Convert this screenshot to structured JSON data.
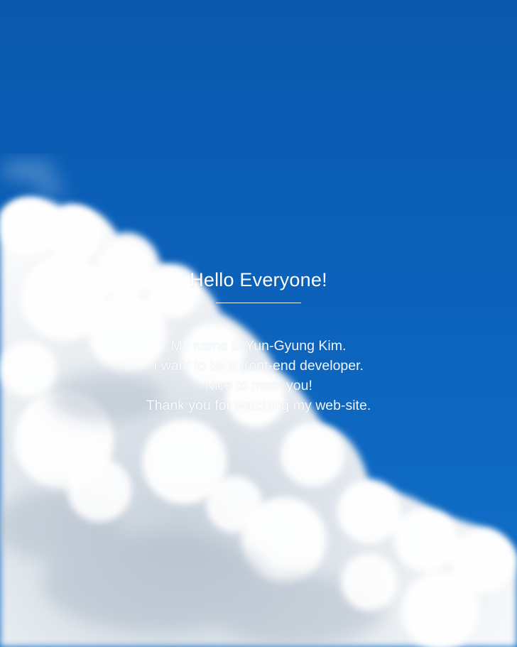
{
  "intro": {
    "title": "Hello Everyone!",
    "lines": [
      "My name is Yun-Gyung Kim.",
      "I want to be a front-end developer.",
      "Nice to meet you!",
      "Thank you for watching my web-site."
    ]
  },
  "colors": {
    "sky": "#0c63bc",
    "cloud": "#ffffff",
    "text": "#ffffff"
  }
}
